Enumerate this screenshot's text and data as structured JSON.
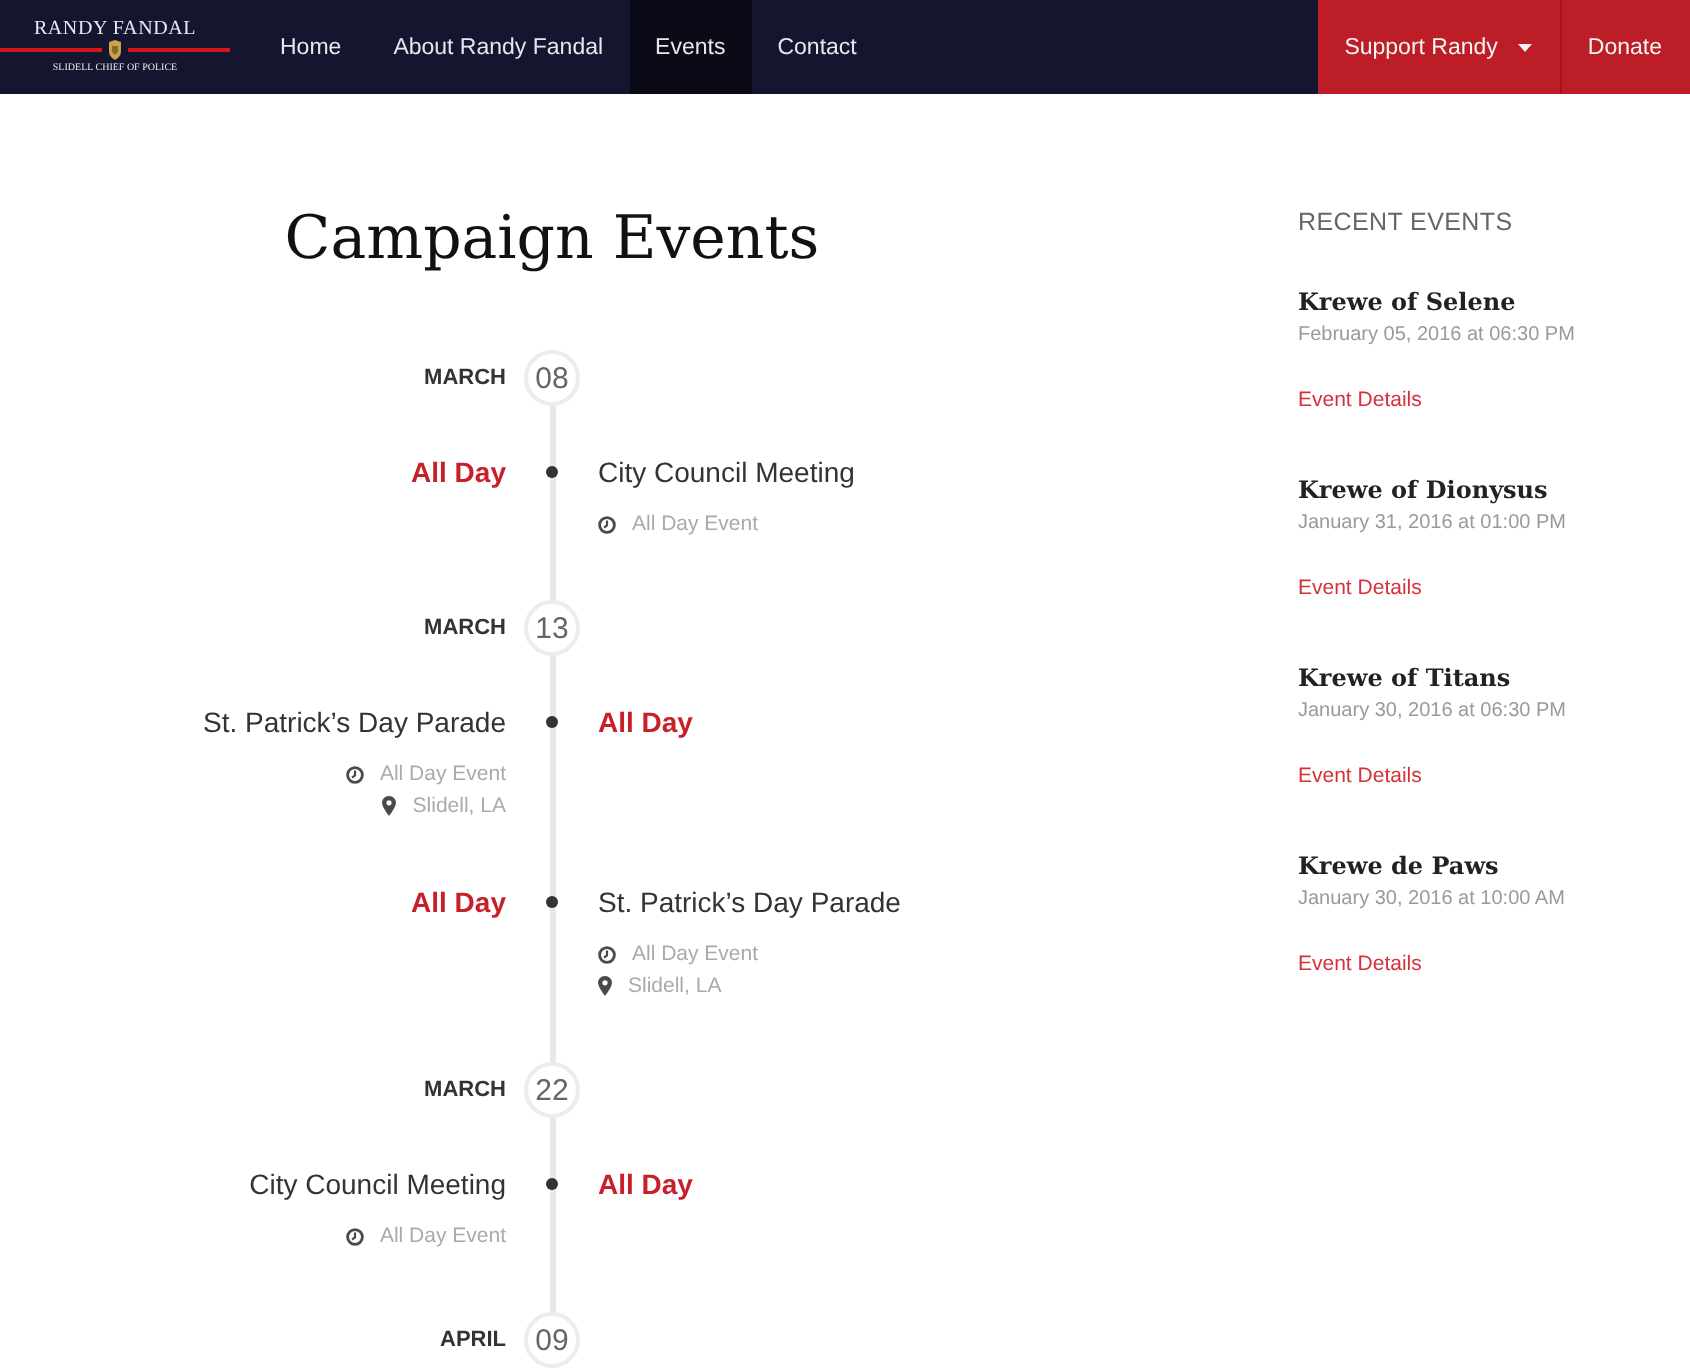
{
  "header": {
    "logo": {
      "name": "RANDY FANDAL",
      "tagline": "SLIDELL CHIEF OF POLICE"
    },
    "nav": [
      {
        "label": "Home",
        "selected": false
      },
      {
        "label": "About Randy Fandal",
        "selected": false
      },
      {
        "label": "Events",
        "selected": true
      },
      {
        "label": "Contact",
        "selected": false
      }
    ],
    "actions": [
      {
        "label": "Support Randy",
        "kind": "dropdown"
      },
      {
        "label": "Donate",
        "kind": "button"
      }
    ]
  },
  "main": {
    "title": "Campaign Events",
    "timeline": [
      {
        "month": "MARCH",
        "day": "08",
        "events": [
          {
            "kind": "right",
            "time": "All Day",
            "title": "City Council Meeting",
            "meta": [
              {
                "kind": "clock",
                "text": "All Day Event"
              }
            ]
          }
        ]
      },
      {
        "month": "MARCH",
        "day": "13",
        "events": [
          {
            "kind": "left",
            "time": "All Day",
            "title": "St. Patrick’s Day Parade",
            "meta": [
              {
                "kind": "clock",
                "text": "All Day Event"
              },
              {
                "kind": "pin",
                "text": "Slidell, LA"
              }
            ]
          },
          {
            "kind": "right",
            "time": "All Day",
            "title": "St. Patrick’s Day Parade",
            "meta": [
              {
                "kind": "clock",
                "text": "All Day Event"
              },
              {
                "kind": "pin",
                "text": "Slidell, LA"
              }
            ]
          }
        ]
      },
      {
        "month": "MARCH",
        "day": "22",
        "events": [
          {
            "kind": "left",
            "time": "All Day",
            "title": "City Council Meeting",
            "meta": [
              {
                "kind": "clock",
                "text": "All Day Event"
              }
            ]
          }
        ]
      },
      {
        "month": "APRIL",
        "day": "09"
      }
    ]
  },
  "sidebar": {
    "heading": "RECENT EVENTS",
    "events": [
      {
        "title": "Krewe of Selene",
        "date": "February 05, 2016 at 06:30 PM",
        "link": "Event Details"
      },
      {
        "title": "Krewe of Dionysus",
        "date": "January 31, 2016 at 01:00 PM",
        "link": "Event Details"
      },
      {
        "title": "Krewe of Titans",
        "date": "January 30, 2016 at 06:30 PM",
        "link": "Event Details"
      },
      {
        "title": "Krewe de Paws",
        "date": "January 30, 2016 at 10:00 AM",
        "link": "Event Details"
      }
    ]
  }
}
